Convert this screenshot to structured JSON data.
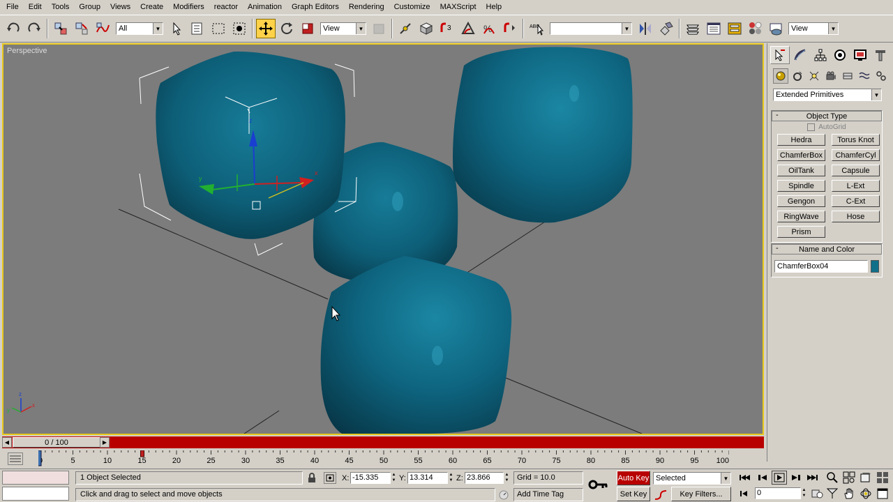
{
  "menu": [
    "File",
    "Edit",
    "Tools",
    "Group",
    "Views",
    "Create",
    "Modifiers",
    "reactor",
    "Animation",
    "Graph Editors",
    "Rendering",
    "Customize",
    "MAXScript",
    "Help"
  ],
  "toolbar": {
    "selection_filter": "All",
    "ref_coord_system": "View",
    "named_selection_set": "",
    "render_view": "View",
    "active_tool": "select-and-move"
  },
  "viewport": {
    "label": "Perspective",
    "background_color": "#7c7c7c",
    "object_color": "#10708a",
    "gizmo_axes": [
      "x",
      "y",
      "z"
    ],
    "corner_axes": [
      "x",
      "y",
      "z"
    ]
  },
  "command_panel": {
    "active_tab": "create",
    "active_category": "geometry",
    "category_dropdown": "Extended Primitives",
    "object_type": {
      "title": "Object Type",
      "autogrid_label": "AutoGrid",
      "buttons": [
        "Hedra",
        "Torus Knot",
        "ChamferBox",
        "ChamferCyl",
        "OilTank",
        "Capsule",
        "Spindle",
        "L-Ext",
        "Gengon",
        "C-Ext",
        "RingWave",
        "Hose",
        "Prism"
      ]
    },
    "name_and_color": {
      "title": "Name and Color",
      "object_name": "ChamferBox04",
      "color": "#10708a"
    }
  },
  "time_slider": {
    "label": "0 / 100",
    "current_frame": 0,
    "total_frames": 100
  },
  "trackbar": {
    "ticks": [
      "0",
      "5",
      "10",
      "15",
      "20",
      "25",
      "30",
      "35",
      "40",
      "45",
      "50",
      "55",
      "60",
      "65",
      "70",
      "75",
      "80",
      "85",
      "90",
      "95",
      "100"
    ],
    "key_frame": 15
  },
  "status": {
    "selection_info": "1 Object Selected",
    "prompt": "Click and drag to select and move objects",
    "x_label": "X:",
    "x_value": "-15.335",
    "y_label": "Y:",
    "y_value": "13.314",
    "z_label": "Z:",
    "z_value": "23.866",
    "grid": "Grid = 10.0",
    "add_time_tag": "Add Time Tag",
    "auto_key": "Auto Key",
    "set_key": "Set Key",
    "key_mode": "Selected",
    "key_filters": "Key Filters...",
    "frame_field": "0"
  }
}
